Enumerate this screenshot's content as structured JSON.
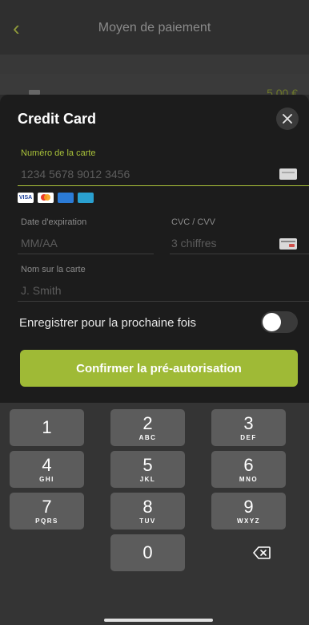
{
  "background": {
    "title": "Moyen de paiement",
    "amount": "5,00 €"
  },
  "sheet": {
    "title": "Credit Card",
    "card_number": {
      "label": "Numéro de la carte",
      "placeholder": "1234 5678 9012 3456",
      "value": ""
    },
    "brands": [
      "VISA",
      "mastercard",
      "amex",
      "cb"
    ],
    "expiry": {
      "label": "Date d'expiration",
      "placeholder": "MM/AA",
      "value": ""
    },
    "cvc": {
      "label": "CVC / CVV",
      "placeholder": "3 chiffres",
      "value": ""
    },
    "name": {
      "label": "Nom sur la carte",
      "placeholder": "J. Smith",
      "value": ""
    },
    "save_label": "Enregistrer pour la prochaine fois",
    "save_enabled": false,
    "confirm_label": "Confirmer la pré-autorisation",
    "accent_color": "#9fba36"
  },
  "keypad": {
    "keys": [
      {
        "digit": "1",
        "letters": ""
      },
      {
        "digit": "2",
        "letters": "ABC"
      },
      {
        "digit": "3",
        "letters": "DEF"
      },
      {
        "digit": "4",
        "letters": "GHI"
      },
      {
        "digit": "5",
        "letters": "JKL"
      },
      {
        "digit": "6",
        "letters": "MNO"
      },
      {
        "digit": "7",
        "letters": "PQRS"
      },
      {
        "digit": "8",
        "letters": "TUV"
      },
      {
        "digit": "9",
        "letters": "WXYZ"
      },
      {
        "digit": "0",
        "letters": ""
      }
    ]
  }
}
